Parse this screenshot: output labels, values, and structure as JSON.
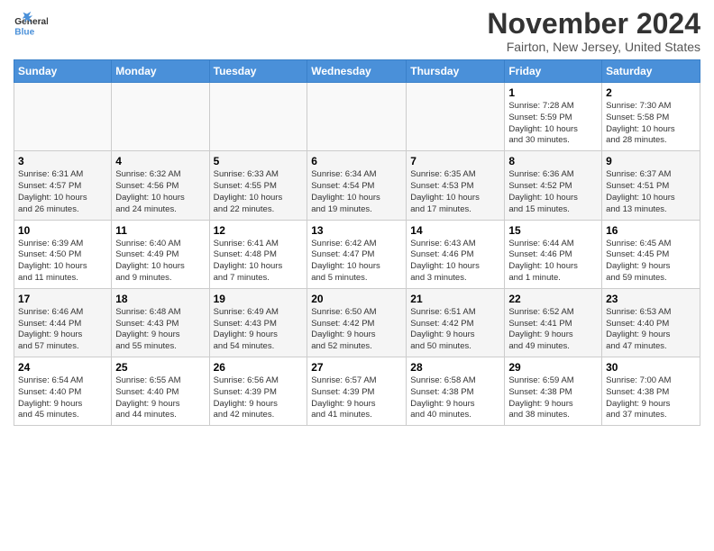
{
  "header": {
    "logo_general": "General",
    "logo_blue": "Blue",
    "month": "November 2024",
    "location": "Fairton, New Jersey, United States"
  },
  "days_of_week": [
    "Sunday",
    "Monday",
    "Tuesday",
    "Wednesday",
    "Thursday",
    "Friday",
    "Saturday"
  ],
  "weeks": [
    {
      "days": [
        {
          "num": "",
          "info": ""
        },
        {
          "num": "",
          "info": ""
        },
        {
          "num": "",
          "info": ""
        },
        {
          "num": "",
          "info": ""
        },
        {
          "num": "",
          "info": ""
        },
        {
          "num": "1",
          "info": "Sunrise: 7:28 AM\nSunset: 5:59 PM\nDaylight: 10 hours\nand 30 minutes."
        },
        {
          "num": "2",
          "info": "Sunrise: 7:30 AM\nSunset: 5:58 PM\nDaylight: 10 hours\nand 28 minutes."
        }
      ]
    },
    {
      "days": [
        {
          "num": "3",
          "info": "Sunrise: 6:31 AM\nSunset: 4:57 PM\nDaylight: 10 hours\nand 26 minutes."
        },
        {
          "num": "4",
          "info": "Sunrise: 6:32 AM\nSunset: 4:56 PM\nDaylight: 10 hours\nand 24 minutes."
        },
        {
          "num": "5",
          "info": "Sunrise: 6:33 AM\nSunset: 4:55 PM\nDaylight: 10 hours\nand 22 minutes."
        },
        {
          "num": "6",
          "info": "Sunrise: 6:34 AM\nSunset: 4:54 PM\nDaylight: 10 hours\nand 19 minutes."
        },
        {
          "num": "7",
          "info": "Sunrise: 6:35 AM\nSunset: 4:53 PM\nDaylight: 10 hours\nand 17 minutes."
        },
        {
          "num": "8",
          "info": "Sunrise: 6:36 AM\nSunset: 4:52 PM\nDaylight: 10 hours\nand 15 minutes."
        },
        {
          "num": "9",
          "info": "Sunrise: 6:37 AM\nSunset: 4:51 PM\nDaylight: 10 hours\nand 13 minutes."
        }
      ]
    },
    {
      "days": [
        {
          "num": "10",
          "info": "Sunrise: 6:39 AM\nSunset: 4:50 PM\nDaylight: 10 hours\nand 11 minutes."
        },
        {
          "num": "11",
          "info": "Sunrise: 6:40 AM\nSunset: 4:49 PM\nDaylight: 10 hours\nand 9 minutes."
        },
        {
          "num": "12",
          "info": "Sunrise: 6:41 AM\nSunset: 4:48 PM\nDaylight: 10 hours\nand 7 minutes."
        },
        {
          "num": "13",
          "info": "Sunrise: 6:42 AM\nSunset: 4:47 PM\nDaylight: 10 hours\nand 5 minutes."
        },
        {
          "num": "14",
          "info": "Sunrise: 6:43 AM\nSunset: 4:46 PM\nDaylight: 10 hours\nand 3 minutes."
        },
        {
          "num": "15",
          "info": "Sunrise: 6:44 AM\nSunset: 4:46 PM\nDaylight: 10 hours\nand 1 minute."
        },
        {
          "num": "16",
          "info": "Sunrise: 6:45 AM\nSunset: 4:45 PM\nDaylight: 9 hours\nand 59 minutes."
        }
      ]
    },
    {
      "days": [
        {
          "num": "17",
          "info": "Sunrise: 6:46 AM\nSunset: 4:44 PM\nDaylight: 9 hours\nand 57 minutes."
        },
        {
          "num": "18",
          "info": "Sunrise: 6:48 AM\nSunset: 4:43 PM\nDaylight: 9 hours\nand 55 minutes."
        },
        {
          "num": "19",
          "info": "Sunrise: 6:49 AM\nSunset: 4:43 PM\nDaylight: 9 hours\nand 54 minutes."
        },
        {
          "num": "20",
          "info": "Sunrise: 6:50 AM\nSunset: 4:42 PM\nDaylight: 9 hours\nand 52 minutes."
        },
        {
          "num": "21",
          "info": "Sunrise: 6:51 AM\nSunset: 4:42 PM\nDaylight: 9 hours\nand 50 minutes."
        },
        {
          "num": "22",
          "info": "Sunrise: 6:52 AM\nSunset: 4:41 PM\nDaylight: 9 hours\nand 49 minutes."
        },
        {
          "num": "23",
          "info": "Sunrise: 6:53 AM\nSunset: 4:40 PM\nDaylight: 9 hours\nand 47 minutes."
        }
      ]
    },
    {
      "days": [
        {
          "num": "24",
          "info": "Sunrise: 6:54 AM\nSunset: 4:40 PM\nDaylight: 9 hours\nand 45 minutes."
        },
        {
          "num": "25",
          "info": "Sunrise: 6:55 AM\nSunset: 4:40 PM\nDaylight: 9 hours\nand 44 minutes."
        },
        {
          "num": "26",
          "info": "Sunrise: 6:56 AM\nSunset: 4:39 PM\nDaylight: 9 hours\nand 42 minutes."
        },
        {
          "num": "27",
          "info": "Sunrise: 6:57 AM\nSunset: 4:39 PM\nDaylight: 9 hours\nand 41 minutes."
        },
        {
          "num": "28",
          "info": "Sunrise: 6:58 AM\nSunset: 4:38 PM\nDaylight: 9 hours\nand 40 minutes."
        },
        {
          "num": "29",
          "info": "Sunrise: 6:59 AM\nSunset: 4:38 PM\nDaylight: 9 hours\nand 38 minutes."
        },
        {
          "num": "30",
          "info": "Sunrise: 7:00 AM\nSunset: 4:38 PM\nDaylight: 9 hours\nand 37 minutes."
        }
      ]
    }
  ],
  "colors": {
    "header_bg": "#4a90d9",
    "header_text": "#ffffff",
    "accent": "#4a90d9"
  }
}
